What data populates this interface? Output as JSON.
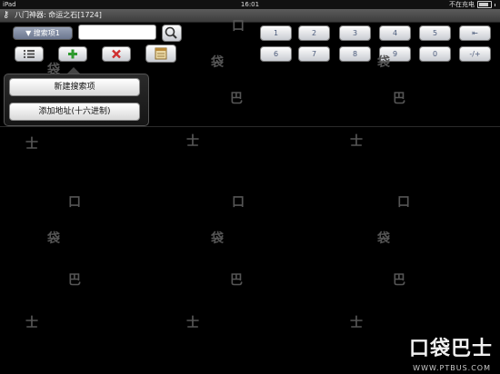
{
  "status_bar": {
    "device": "iPad",
    "time": "16:01",
    "charging": "不在充电"
  },
  "title_bar": {
    "title": "八门神器: 命运之石[1724]"
  },
  "toolbar": {
    "search_item_label": "▼ 搜索项1",
    "search_input_value": "",
    "search_icon": "🔍",
    "list_icon": "☰",
    "add_icon": "+",
    "delete_icon": "✕",
    "notepad_icon": "✎"
  },
  "keypad": {
    "row1": [
      "1",
      "2",
      "3",
      "4",
      "5",
      "⇤"
    ],
    "row2": [
      "6",
      "7",
      "8",
      "9",
      "0",
      "-/+"
    ]
  },
  "dropdown": {
    "items": [
      "新建搜索项",
      "添加地址(十六进制)"
    ]
  },
  "watermark": {
    "brand": "口袋巴士",
    "url": "WWW.PTBUS.COM"
  }
}
